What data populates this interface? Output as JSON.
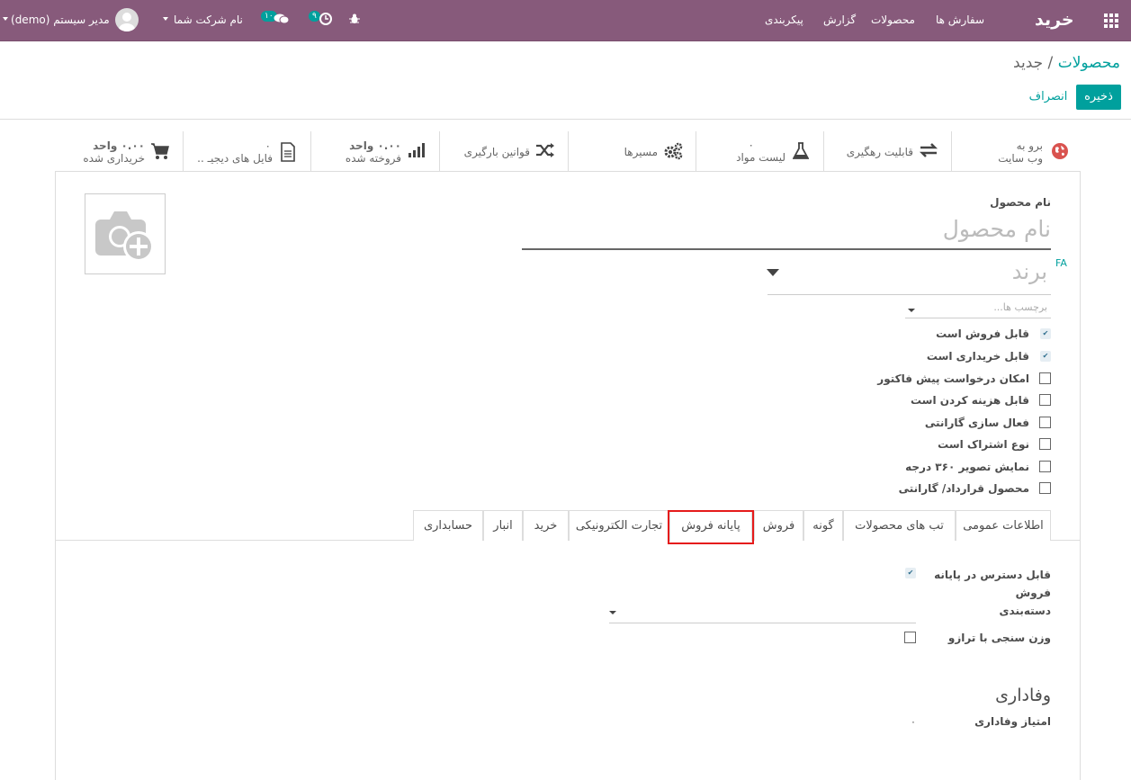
{
  "navbar": {
    "app_title": "خرید",
    "menu": [
      "سفارش ها",
      "محصولات",
      "گزارش",
      "پیکربندی"
    ],
    "activity_count": "۹",
    "messages_count": "۱۰",
    "company": "نام شرکت شما",
    "user": "مدیر سیستم (demo)"
  },
  "breadcrumb": {
    "parent": "محصولات",
    "separator": "/",
    "current": "جدید"
  },
  "actions": {
    "save": "ذخیره",
    "discard": "انصراف"
  },
  "smart_buttons": [
    {
      "name": "website",
      "line1": "برو به",
      "line2": "وب سایت",
      "icon": "globe-icon"
    },
    {
      "name": "traceability",
      "line1": "قابلیت رهگیری",
      "line2": "",
      "icon": "exchange-icon"
    },
    {
      "name": "bom",
      "line1": "۰",
      "line2": "لیست مواد",
      "icon": "flask-icon"
    },
    {
      "name": "routes",
      "line1": "مسیرها",
      "line2": "",
      "icon": "cogs-icon"
    },
    {
      "name": "putaway",
      "line1": "قوانین بارگیری",
      "line2": "",
      "icon": "random-icon"
    },
    {
      "name": "sold",
      "line1": "۰.۰۰ واحد",
      "line2": "فروخته شده",
      "icon": "bar-chart-icon"
    },
    {
      "name": "digital-files",
      "line1": "۰",
      "line2": "فایل های دیجیـ ..",
      "icon": "file-icon"
    },
    {
      "name": "purchased",
      "line1": "۰.۰۰ واحد",
      "line2": "خریداری شده",
      "icon": "cart-icon"
    }
  ],
  "form": {
    "name_label": "نام محصول",
    "name_placeholder": "نام محصول",
    "lang_tag": "FA",
    "brand_placeholder": "برند",
    "tags_placeholder": "برچسب ها...",
    "checkboxes": [
      {
        "label": "قابل فروش است",
        "checked": true
      },
      {
        "label": "قابل خریداری است",
        "checked": true
      },
      {
        "label": "امکان درخواست پیش فاکتور",
        "checked": false
      },
      {
        "label": "قابل هزینه کردن است",
        "checked": false
      },
      {
        "label": "فعال سازی گارانتی",
        "checked": false
      },
      {
        "label": "نوع اشتراک است",
        "checked": false
      },
      {
        "label": "نمایش تصویر ۳۶۰ درجه",
        "checked": false
      },
      {
        "label": "محصول قرارداد/ گارانتی",
        "checked": false
      }
    ]
  },
  "tabs": [
    "اطلاعات عمومی",
    "تب های محصولات",
    "گونه",
    "فروش",
    "پایانه فروش",
    "تجارت الکترونیکی",
    "خرید",
    "انبار",
    "حسابداری"
  ],
  "active_tab": "پایانه فروش",
  "pos": {
    "available_label_1": "قابل دسترس در پایانه",
    "available_label_2": "فروش",
    "available_checked": true,
    "category_label": "دسته‌بندی",
    "scale_label": "وزن سنجی با ترازو",
    "scale_checked": false
  },
  "loyalty": {
    "title": "وفاداری",
    "points_label": "امتیاز وفاداری",
    "points_value": "۰"
  }
}
